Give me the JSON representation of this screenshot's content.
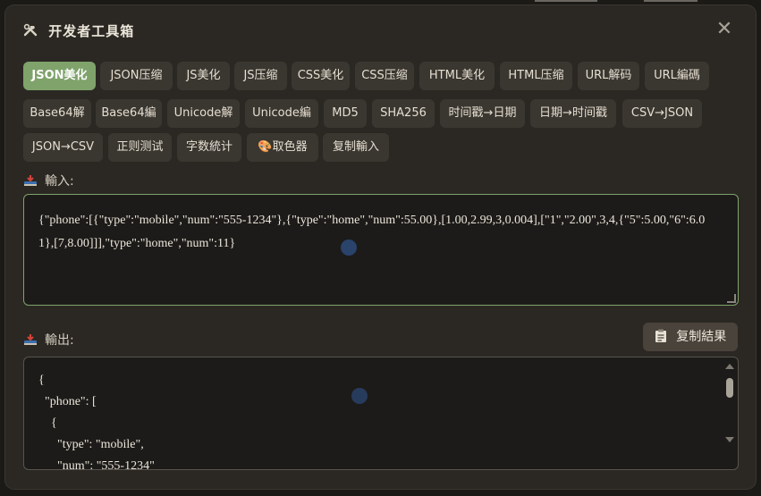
{
  "dialog": {
    "title": "开发者工具箱",
    "title_icon": "hammer-wrench-icon",
    "close_glyph": "✕"
  },
  "tools": {
    "row1": [
      "JSON美化",
      "JSON压缩",
      "JS美化",
      "JS压缩",
      "CSS美化",
      "CSS压缩",
      "HTML美化",
      "HTML压缩",
      "URL解码",
      "URL編碼"
    ],
    "row2": [
      "Base64解",
      "Base64編",
      "Unicode解",
      "Unicode編",
      "MD5",
      "SHA256",
      "时间戳→日期",
      "日期→时间戳",
      "CSV→JSON"
    ],
    "row3": [
      "JSON→CSV",
      "正则测试",
      "字数統计",
      "🎨取色器",
      "复制輸入"
    ],
    "active": "JSON美化"
  },
  "input": {
    "label": "輸入:",
    "icon": "inbox-tray-icon",
    "value": "{\"phone\":[{\"type\":\"mobile\",\"num\":\"555-1234\"},{\"type\":\"home\",\"num\":55.00},[1.00,2.99,3,0.004],[\"1\",\"2.00\",3,4,{\"5\":5.00,\"6\":6.01},[7,8.00]]],\"type\":\"home\",\"num\":11}"
  },
  "output": {
    "label": "輸出:",
    "icon": "inbox-tray-icon",
    "copy_button": "复制結果",
    "copy_icon": "clipboard-icon",
    "lines": [
      "{",
      "  \"phone\": [",
      "    {",
      "      \"type\": \"mobile\",",
      "      \"num\": \"555-1234\""
    ]
  },
  "colors": {
    "accent": "#7fa36b",
    "panel": "#2b2823",
    "chip": "#3a3630",
    "textarea": "#1c1b19"
  }
}
